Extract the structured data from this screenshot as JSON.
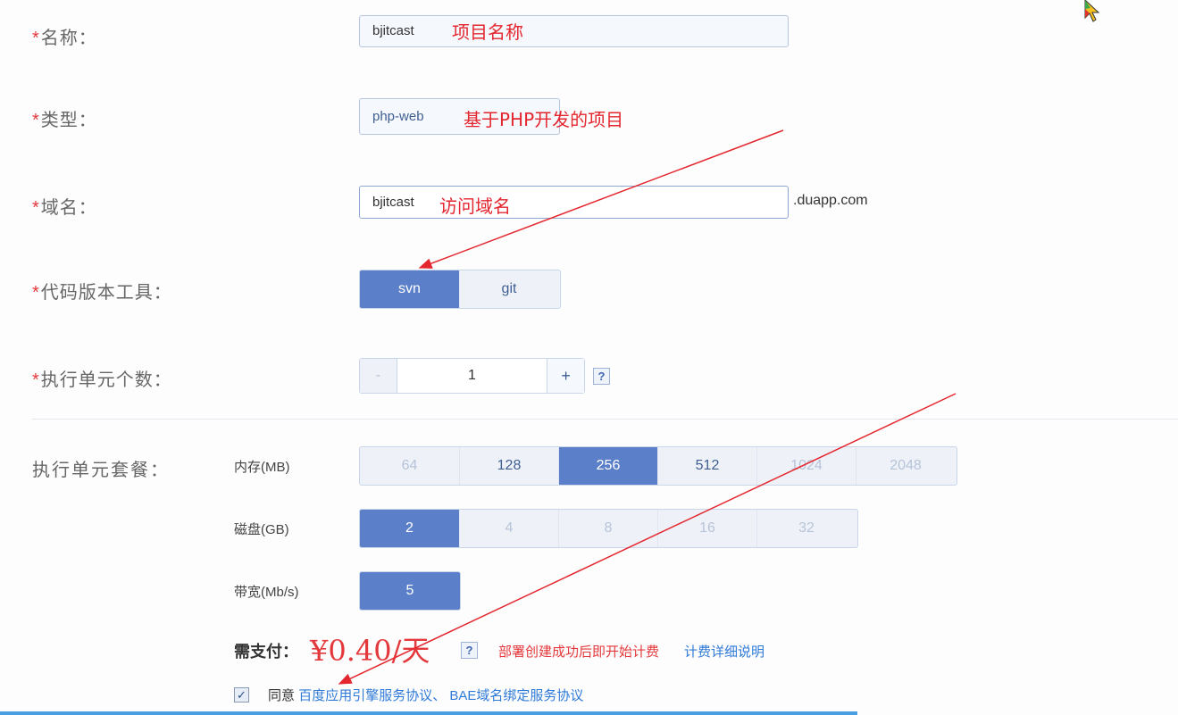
{
  "fields": {
    "name": {
      "label": "名称：",
      "value": "bjitcast",
      "note": "项目名称"
    },
    "type": {
      "label": "类型：",
      "value": "php-web",
      "note": "基于PHP开发的项目"
    },
    "domain": {
      "label": "域名：",
      "value": "bjitcast",
      "note": "访问域名",
      "suffix": ".duapp.com"
    },
    "vcs": {
      "label": "代码版本工具：",
      "options": [
        "svn",
        "git"
      ],
      "selected": "svn"
    },
    "units": {
      "label": "执行单元个数：",
      "minus": "-",
      "value": "1",
      "plus": "+",
      "help": "?"
    }
  },
  "required_mark": "*",
  "package": {
    "label": "执行单元套餐：",
    "memory": {
      "label": "内存(MB)",
      "options": [
        "64",
        "128",
        "256",
        "512",
        "1024",
        "2048"
      ],
      "selected": "256",
      "disabled": [
        "64",
        "1024",
        "2048"
      ]
    },
    "disk": {
      "label": "磁盘(GB)",
      "options": [
        "2",
        "4",
        "8",
        "16",
        "32"
      ],
      "selected": "2",
      "disabled": [
        "4",
        "8",
        "16",
        "32"
      ]
    },
    "bandwidth": {
      "label": "带宽(Mb/s)",
      "options": [
        "5"
      ],
      "selected": "5"
    }
  },
  "payment": {
    "label": "需支付：",
    "price": "¥0.40/天",
    "help": "?",
    "notice": "部署创建成功后即开始计费",
    "details_link": "计费详细说明"
  },
  "agreement": {
    "checked": true,
    "prefix": "同意",
    "link1": "百度应用引擎服务协议",
    "sep": "、",
    "link2": "BAE域名绑定服务协议"
  },
  "colors": {
    "accent": "#5b7fc8",
    "annotation": "#e4262f",
    "link": "#2f7ad7"
  }
}
